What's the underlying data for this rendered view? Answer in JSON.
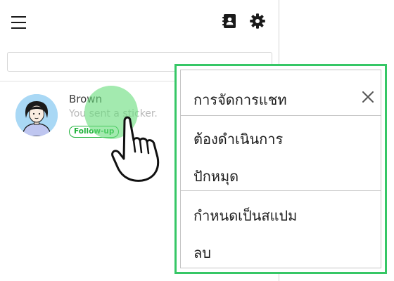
{
  "toolbar": {
    "menu_icon": "hamburger-menu-icon",
    "contacts_icon": "contacts-book-icon",
    "settings_icon": "gear-icon"
  },
  "search": {
    "placeholder": "",
    "value": ""
  },
  "chat_list": [
    {
      "name": "Brown",
      "preview": "You sent a sticker.",
      "badge": "Follow-up",
      "avatar_icon": "user-avatar"
    }
  ],
  "context_menu": {
    "title": "การจัดการแชท",
    "close_icon": "close-icon",
    "items": [
      "ต้องดำเนินการ",
      "ปักหมุด",
      "กำหนดเป็นสแปม",
      "ลบ"
    ]
  },
  "colors": {
    "accent_green": "#36c766",
    "badge_green": "#1fb13a",
    "touch_highlight": "#66dc7a"
  }
}
